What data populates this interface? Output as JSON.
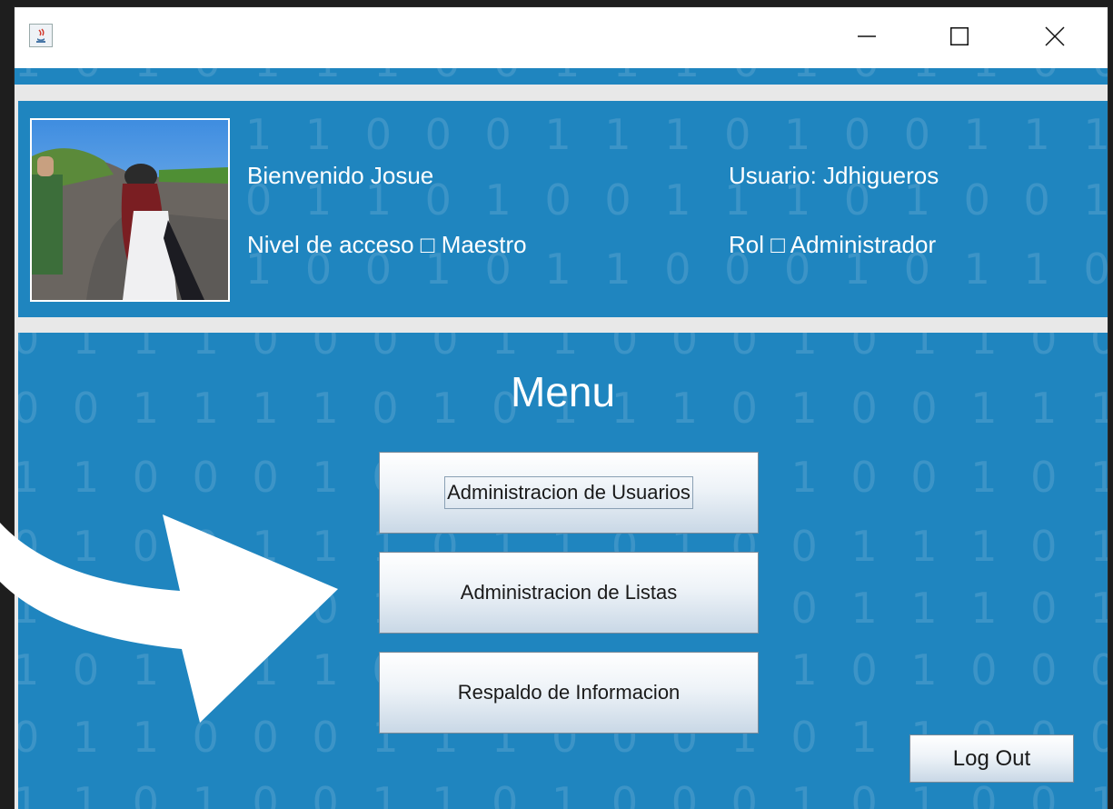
{
  "header": {
    "welcome": "Bienvenido Josue",
    "user": "Usuario: Jdhigueros",
    "access_level": "Nivel de acceso □ Maestro",
    "role": "Rol □ Administrador"
  },
  "menu": {
    "title": "Menu",
    "buttons": [
      "Administracion de Usuarios",
      "Administracion de Listas",
      "Respaldo de Informacion"
    ],
    "logout": "Log Out"
  },
  "background_binary": [
    "1 0 1 0 1 1 1 0 0 1 1 1 0 1 0 1 1 0 0 1 0 1",
    "1 1 0 0 0 1 1 1 0 1 0 0 1 1 1 0 1 0 0 1",
    "0 1 1 0 1 0 0 1 1 1 0 1 0 0 1 1 1 0 1 0",
    "1 0 0 1 0 1 1 0 0 0 1 0 1 1 0 0 0 1 0",
    "0 1 1 1 0 0 0 0 1 1 0 0 0 1 0 1 1 0 0 0 1 1 1",
    "0 0 1 1 1 1 0 1 0 1 1 1 0 1 0 0 1 1 1 0 1 0 0 1 1",
    "1 1 0 0 0 1 0 1 0 0 1 1 0 1 0 0 1 0 1 1 0 0",
    "0 1 0 0 1 1 1 0 1 1 0 1 0 0 1 1 1 0 1 0 0",
    "1 0 0 1 1 0 1 0 1 1 0 1 0 0 1 1 1 0 1",
    "1 0 1 0 1 1 0 0 1 0 0 1 1 1 0 1 0 0 0 1 0 1",
    "0 1 1 0 0 0 1 1 1 0 0 0 1 0 1 1 0 0 0 1 1 1",
    "1 1 0 1 0 0 1 1 0 1 0 0 0 1 0 1 0 0 1 1 0 0"
  ],
  "colors": {
    "panel": "#1f85bf",
    "separator": "#e8e8e8",
    "titlebar": "#ffffff"
  },
  "icons": {
    "app": "java-app-icon",
    "minimize": "minimize-icon",
    "maximize": "maximize-icon",
    "close": "close-icon",
    "annotation": "curved-arrow-icon"
  }
}
